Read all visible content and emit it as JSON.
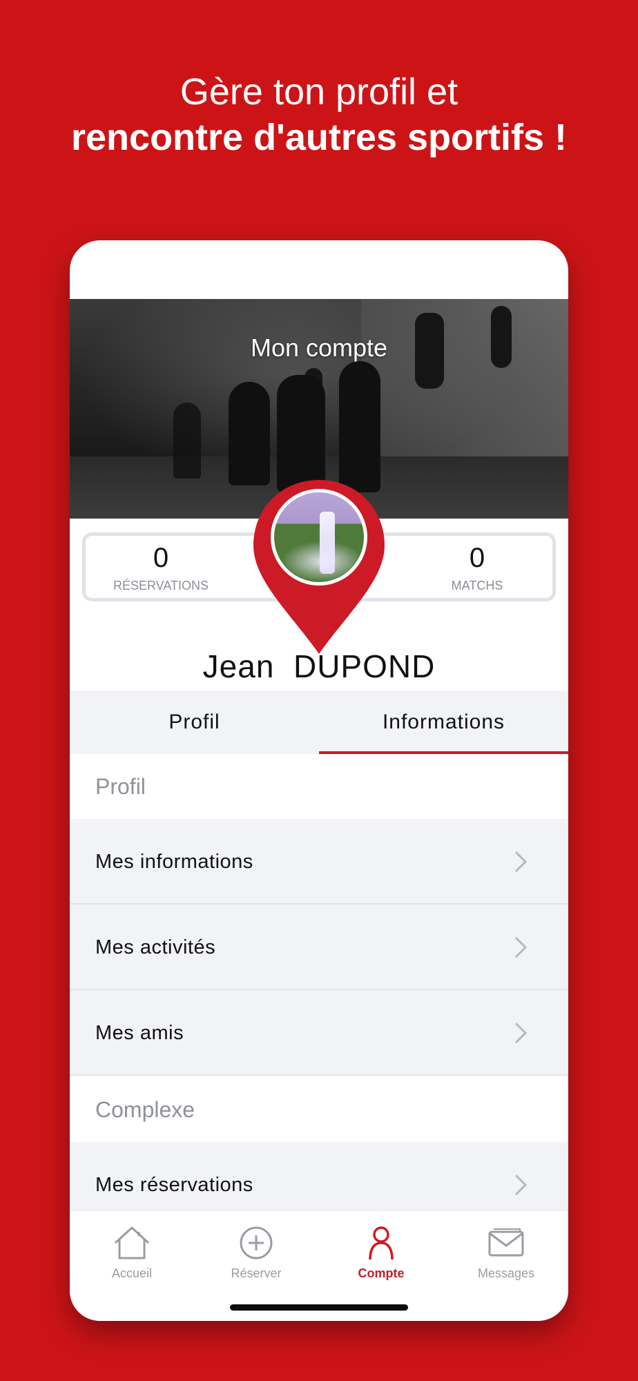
{
  "headline": {
    "line1": "Gère ton profil et",
    "line2": "rencontre d'autres sportifs !"
  },
  "account": {
    "title": "Mon compte",
    "stats": {
      "reservations_count": "0",
      "reservations_label": "RÉSERVATIONS",
      "matches_count": "0",
      "matches_label": "MATCHS"
    },
    "user": {
      "first_name": "Jean",
      "last_name": "DUPOND"
    }
  },
  "tabs": [
    {
      "label": "Profil"
    },
    {
      "label": "Informations"
    }
  ],
  "sections": [
    {
      "header": "Profil",
      "items": [
        {
          "label": "Mes informations"
        },
        {
          "label": "Mes activités"
        },
        {
          "label": "Mes amis"
        }
      ]
    },
    {
      "header": "Complexe",
      "items": [
        {
          "label": "Mes réservations"
        }
      ]
    }
  ],
  "bottom_nav": [
    {
      "label": "Accueil",
      "icon": "home-icon"
    },
    {
      "label": "Réserver",
      "icon": "plus-circle-icon"
    },
    {
      "label": "Compte",
      "icon": "user-icon"
    },
    {
      "label": "Messages",
      "icon": "envelope-icon"
    }
  ],
  "colors": {
    "brand_red": "#cc1417",
    "accent_red": "#cc1a27",
    "list_bg": "#f2f3f6",
    "muted_text": "#8e9199"
  }
}
